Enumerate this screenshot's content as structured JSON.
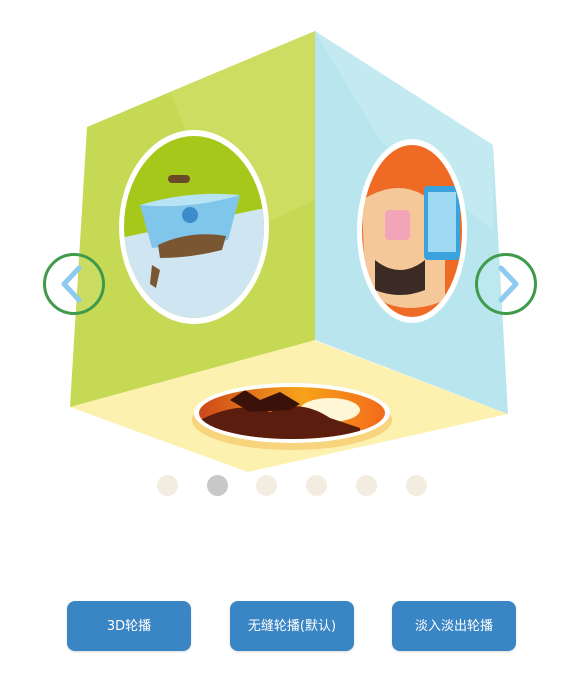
{
  "carousel": {
    "slide_count": 6,
    "active_index": 1,
    "colors": {
      "front_face": "#c6d955",
      "right_face": "#b9e6ee",
      "bottom_face": "#fdf1b0",
      "arrow_border": "#3f9a4a",
      "arrow_chevron": "#8ecbf0",
      "dot_inactive": "#f2ede0",
      "dot_active": "#c8c8c8"
    },
    "images": [
      "dog-bowl-illustration",
      "phone-user-illustration",
      "sunset-silhouette-illustration"
    ],
    "prev_icon": "chevron-left-icon",
    "next_icon": "chevron-right-icon"
  },
  "buttons": {
    "btn_3d": "3D轮播",
    "btn_seamless": "无缝轮播(默认)",
    "btn_fade": "淡入淡出轮播"
  }
}
